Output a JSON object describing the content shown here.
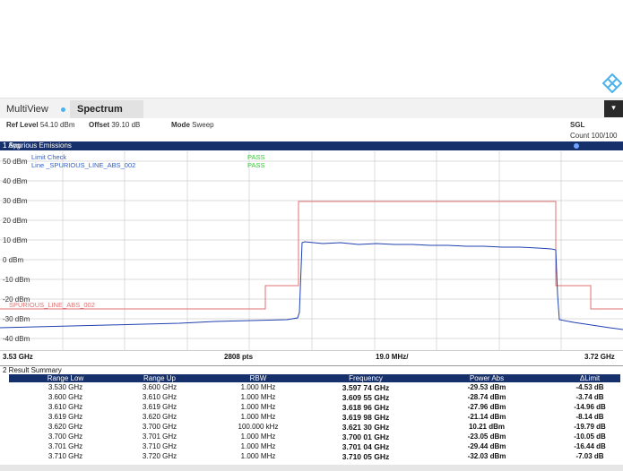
{
  "header": {
    "app": "MultiView",
    "tab": "Spectrum",
    "menu": "▾"
  },
  "settings": {
    "ref_level_label": "Ref Level",
    "ref_level_value": "54.10 dBm",
    "offset_label": "Offset",
    "offset_value": "39.10 dB",
    "mode_label": "Mode",
    "mode_value": "Sweep",
    "sgl": "SGL",
    "count": "Count 100/100"
  },
  "panel1": {
    "title": "1 Spurious Emissions",
    "avg": "1 Avg"
  },
  "plot": {
    "limit_check": "Limit Check",
    "line_name": "Line _SPURIOUS_LINE_ABS_002",
    "pass1": "PASS",
    "pass2": "PASS",
    "limit_label": "SPURIOUS_LINE_ABS_002",
    "y_labels": [
      "50 dBm",
      "40 dBm",
      "30 dBm",
      "20 dBm",
      "10 dBm",
      "0 dBm",
      "-10 dBm",
      "-20 dBm",
      "-30 dBm",
      "-40 dBm"
    ]
  },
  "xaxis": {
    "start": "3.53 GHz",
    "pts": "2808 pts",
    "span": "19.0 MHz/",
    "stop": "3.72 GHz"
  },
  "panel2": {
    "title": "2 Result Summary"
  },
  "table": {
    "headers": [
      "Range Low",
      "Range Up",
      "RBW",
      "Frequency",
      "Power Abs",
      "ΔLimit"
    ],
    "rows": [
      [
        "3.530 GHz",
        "3.600 GHz",
        "1.000 MHz",
        "3.597 74 GHz",
        "-29.53 dBm",
        "-4.53 dB"
      ],
      [
        "3.600 GHz",
        "3.610 GHz",
        "1.000 MHz",
        "3.609 55 GHz",
        "-28.74 dBm",
        "-3.74 dB"
      ],
      [
        "3.610 GHz",
        "3.619 GHz",
        "1.000 MHz",
        "3.618 96 GHz",
        "-27.96 dBm",
        "-14.96 dB"
      ],
      [
        "3.619 GHz",
        "3.620 GHz",
        "1.000 MHz",
        "3.619 98 GHz",
        "-21.14 dBm",
        "-8.14 dB"
      ],
      [
        "3.620 GHz",
        "3.700 GHz",
        "100.000 kHz",
        "3.621 30 GHz",
        "10.21 dBm",
        "-19.79 dB"
      ],
      [
        "3.700 GHz",
        "3.701 GHz",
        "1.000 MHz",
        "3.700 01 GHz",
        "-23.05 dBm",
        "-10.05 dB"
      ],
      [
        "3.701 GHz",
        "3.710 GHz",
        "1.000 MHz",
        "3.701 04 GHz",
        "-29.44 dBm",
        "-16.44 dB"
      ],
      [
        "3.710 GHz",
        "3.720 GHz",
        "1.000 MHz",
        "3.710 05 GHz",
        "-32.03 dBm",
        "-7.03 dB"
      ]
    ]
  },
  "colors": {
    "accent": "#16306b",
    "trace": "#2040b0",
    "limit": "#e07070",
    "pass": "#33cc33"
  }
}
